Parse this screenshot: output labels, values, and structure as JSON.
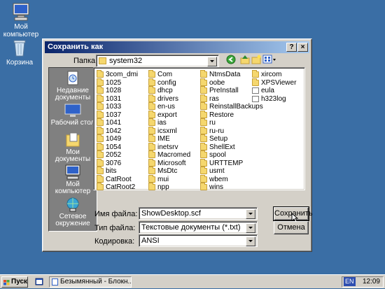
{
  "desktop": {
    "icons": [
      {
        "label_line1": "Мой",
        "label_line2": "компьютер"
      },
      {
        "label": "Корзина"
      }
    ]
  },
  "dialog": {
    "title": "Сохранить как",
    "help_btn": "?",
    "close_btn": "×",
    "folder_label": "Папка:",
    "folder_value": "system32",
    "places": [
      {
        "line1": "Недавние",
        "line2": "документы"
      },
      {
        "line1": "Рабочий стол",
        "line2": ""
      },
      {
        "line1": "Мои",
        "line2": "документы"
      },
      {
        "line1": "Мой",
        "line2": "компьютер"
      },
      {
        "line1": "Сетевое",
        "line2": "окружение"
      }
    ],
    "files": {
      "col1": [
        "3com_dmi",
        "1025",
        "1028",
        "1031",
        "1033",
        "1037",
        "1041",
        "1042",
        "1049",
        "1054",
        "2052",
        "3076",
        "bits",
        "CatRoot",
        "CatRoot2"
      ],
      "col2": [
        "Com",
        "config",
        "dhcp",
        "drivers",
        "en-us",
        "export",
        "ias",
        "icsxml",
        "IME",
        "inetsrv",
        "Macromed",
        "Microsoft",
        "MsDtc",
        "mui",
        "npp"
      ],
      "col3": [
        "NtmsData",
        "oobe",
        "PreInstall",
        "ras",
        "ReinstallBackups",
        "Restore",
        "ru",
        "ru-ru",
        "Setup",
        "ShellExt",
        "spool",
        "URTTEMP",
        "usmt",
        "wbem",
        "wins"
      ],
      "col4": [
        {
          "name": "xircom",
          "kind": "folder"
        },
        {
          "name": "XPSViewer",
          "kind": "folder"
        },
        {
          "name": "eula",
          "kind": "doc"
        },
        {
          "name": "h323log",
          "kind": "doc"
        }
      ]
    },
    "filename_label": "Имя файла:",
    "filename_value": "ShowDesktop.scf",
    "filetype_label": "Тип файла:",
    "filetype_value": "Текстовые документы (*.txt)",
    "encoding_label": "Кодировка:",
    "encoding_value": "ANSI",
    "save_label": "Сохранить",
    "cancel_label": "Отмена"
  },
  "taskbar": {
    "start_label": "Пуск",
    "task_label": "Безымянный - Блокн...",
    "lang": "EN",
    "clock": "12:09"
  },
  "colors": {
    "desktop": "#3a6ea5",
    "titlebar_start": "#0a246a",
    "titlebar_end": "#a6caf0",
    "face": "#d4d0c8",
    "folder": "#f5d76e"
  }
}
